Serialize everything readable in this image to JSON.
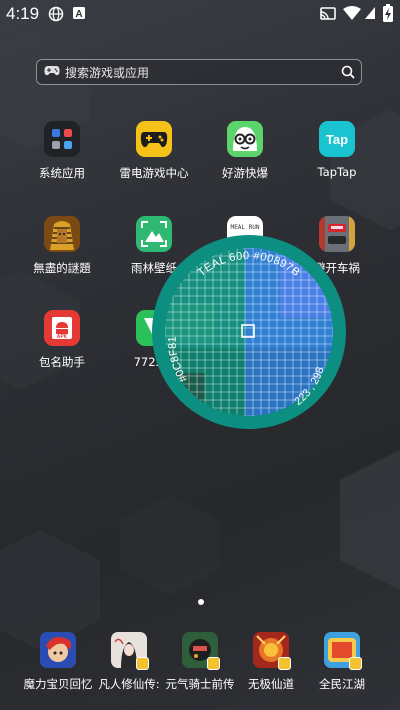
{
  "status": {
    "time": "4:19"
  },
  "search": {
    "placeholder": "搜索游戏或应用"
  },
  "apps": [
    {
      "label": "系统应用"
    },
    {
      "label": "雷电游戏中心"
    },
    {
      "label": "好游快爆"
    },
    {
      "label": "TapTap",
      "icon_text": "Tap"
    },
    {
      "label": "無盡的謎題"
    },
    {
      "label": "雨林壁纸"
    },
    {
      "label": "",
      "icon_text": "MEAL RUN"
    },
    {
      "label": "避开车祸"
    },
    {
      "label": "包名助手",
      "icon_text": "APK"
    },
    {
      "label": "7723游"
    }
  ],
  "dock": [
    {
      "label": "魔力宝贝回忆"
    },
    {
      "label": "凡人修仙传:"
    },
    {
      "label": "元气骑士前传"
    },
    {
      "label": "无极仙道"
    },
    {
      "label": "全民江湖"
    }
  ],
  "magnifier": {
    "color_name": "TEAL 600",
    "hex_top": "#00897B",
    "hex_left": "#0C8F81",
    "coords": "223 , 298",
    "ring_color": "#0c8f81"
  },
  "colors": {
    "taptap": "#19c4d0",
    "leidian": "#f6c21a",
    "haoyou": "#5bd46c",
    "apk": "#e53935",
    "green": "#2eb872"
  }
}
